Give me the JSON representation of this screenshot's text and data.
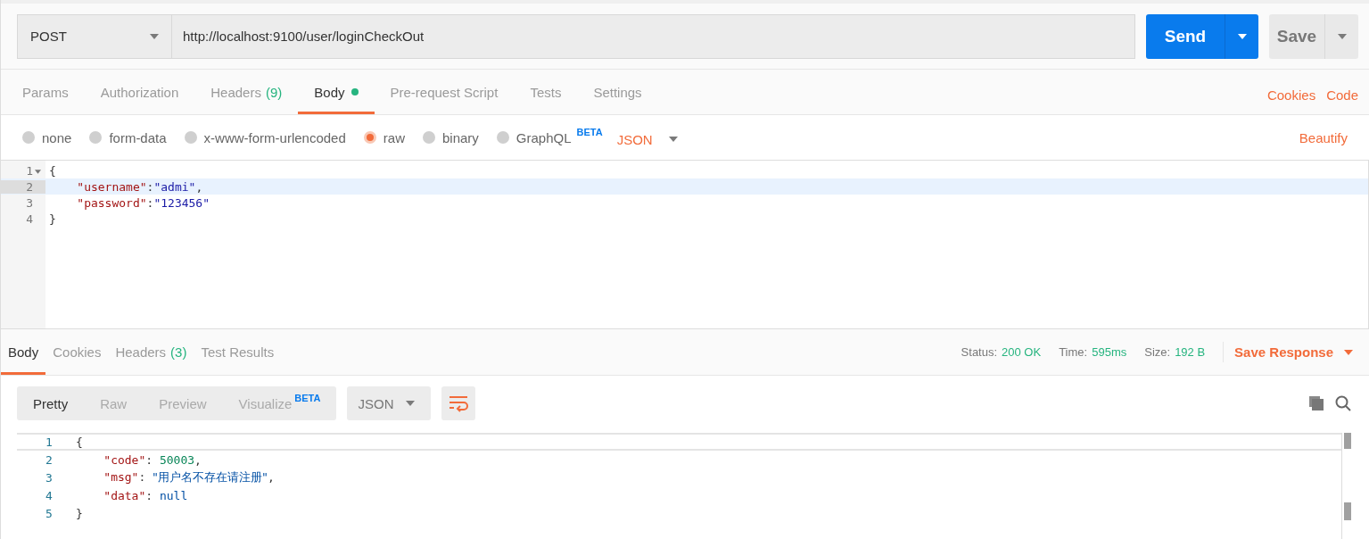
{
  "request": {
    "method": "POST",
    "url": "http://localhost:9100/user/loginCheckOut",
    "send": "Send",
    "save": "Save"
  },
  "request_tabs": [
    {
      "label": "Params",
      "selected": false
    },
    {
      "label": "Authorization",
      "selected": false
    },
    {
      "label": "Headers",
      "count": "(9)",
      "selected": false
    },
    {
      "label": "Body",
      "selected": true,
      "dot": true
    },
    {
      "label": "Pre-request Script",
      "selected": false
    },
    {
      "label": "Tests",
      "selected": false
    },
    {
      "label": "Settings",
      "selected": false
    }
  ],
  "request_links": [
    "Cookies",
    "Code"
  ],
  "body_types": [
    {
      "label": "none",
      "selected": false
    },
    {
      "label": "form-data",
      "selected": false
    },
    {
      "label": "x-www-form-urlencoded",
      "selected": false
    },
    {
      "label": "raw",
      "selected": true
    },
    {
      "label": "binary",
      "selected": false
    },
    {
      "label": "GraphQL",
      "badge": "BETA",
      "selected": false
    }
  ],
  "body_format": "JSON",
  "beautify": "Beautify",
  "editor": {
    "lines": [
      {
        "number": "1",
        "foldable": true,
        "active": false,
        "tokens": [
          {
            "kind": "punct",
            "text": "{"
          }
        ]
      },
      {
        "number": "2",
        "foldable": false,
        "active": true,
        "tokens": [
          {
            "kind": "key",
            "text": "    \"username\""
          },
          {
            "kind": "punct",
            "text": ":"
          },
          {
            "kind": "string",
            "text": "\"admi\""
          },
          {
            "kind": "punct",
            "text": ","
          }
        ]
      },
      {
        "number": "3",
        "foldable": false,
        "active": false,
        "tokens": [
          {
            "kind": "key",
            "text": "    \"password\""
          },
          {
            "kind": "punct",
            "text": ":"
          },
          {
            "kind": "string",
            "text": "\"123456\""
          }
        ]
      },
      {
        "number": "4",
        "foldable": false,
        "active": false,
        "tokens": [
          {
            "kind": "punct",
            "text": "}"
          }
        ]
      }
    ]
  },
  "response_tabs": [
    {
      "label": "Body",
      "selected": true
    },
    {
      "label": "Cookies",
      "selected": false
    },
    {
      "label": "Headers",
      "count": "(3)",
      "selected": false
    },
    {
      "label": "Test Results",
      "selected": false
    }
  ],
  "response_stats": [
    {
      "label": "Status:",
      "value": "200 OK"
    },
    {
      "label": "Time:",
      "value": "595ms"
    },
    {
      "label": "Size:",
      "value": "192 B"
    }
  ],
  "save_response": "Save Response",
  "view_modes": [
    {
      "label": "Pretty",
      "selected": true
    },
    {
      "label": "Raw",
      "selected": false
    },
    {
      "label": "Preview",
      "selected": false
    },
    {
      "label": "Visualize",
      "badge": "BETA",
      "selected": false
    }
  ],
  "response_format": "JSON",
  "response": {
    "lines": [
      {
        "number": "1",
        "active": true,
        "tokens": [
          {
            "kind": "punct",
            "text": "{"
          }
        ]
      },
      {
        "number": "2",
        "active": false,
        "tokens": [
          {
            "kind": "rkey",
            "text": "    \"code\""
          },
          {
            "kind": "punct",
            "text": ": "
          },
          {
            "kind": "number",
            "text": "50003"
          },
          {
            "kind": "punct",
            "text": ","
          }
        ]
      },
      {
        "number": "3",
        "active": false,
        "tokens": [
          {
            "kind": "rkey",
            "text": "    \"msg\""
          },
          {
            "kind": "punct",
            "text": ": "
          },
          {
            "kind": "rstring",
            "text": "\"用户名不存在请注册\""
          },
          {
            "kind": "punct",
            "text": ","
          }
        ]
      },
      {
        "number": "4",
        "active": false,
        "tokens": [
          {
            "kind": "rkey",
            "text": "    \"data\""
          },
          {
            "kind": "punct",
            "text": ": "
          },
          {
            "kind": "null",
            "text": "null"
          }
        ]
      },
      {
        "number": "5",
        "active": false,
        "tokens": [
          {
            "kind": "punct",
            "text": "}"
          }
        ]
      }
    ]
  }
}
